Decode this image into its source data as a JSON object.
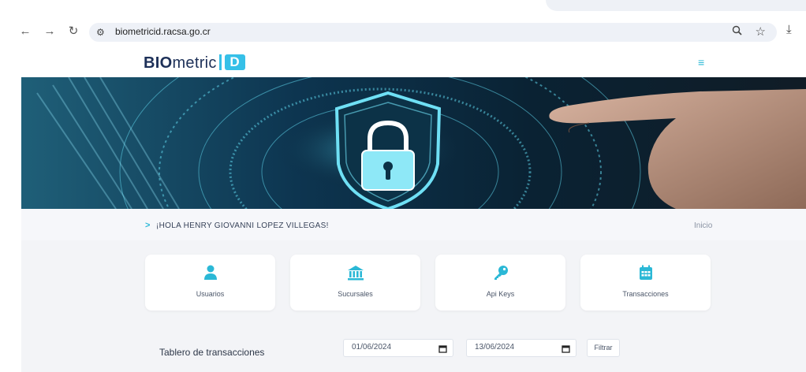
{
  "browser": {
    "url": "biometricid.racsa.go.cr",
    "icons": [
      "back-icon",
      "forward-icon",
      "reload-icon",
      "site-settings-icon",
      "zoom-icon",
      "star-icon",
      "download-icon"
    ]
  },
  "brand": {
    "bold": "BIO",
    "light": "metric",
    "badge": "D"
  },
  "greeting": {
    "text": "¡HOLA HENRY GIOVANNI LOPEZ VILLEGAS!",
    "breadcrumb": "Inicio"
  },
  "cards": [
    {
      "label": "Usuarios",
      "icon": "user-icon"
    },
    {
      "label": "Sucursales",
      "icon": "bank-icon"
    },
    {
      "label": "Api Keys",
      "icon": "key-icon"
    },
    {
      "label": "Transacciones",
      "icon": "calendar-icon"
    }
  ],
  "dashboard": {
    "title": "Tablero de transacciones",
    "date_from": "01/06/2024",
    "date_to": "13/06/2024",
    "filter_label": "Filtrar"
  },
  "colors": {
    "accent": "#2bb8d6",
    "brand_dark": "#1d3058",
    "hero_dark": "#0b2233"
  }
}
